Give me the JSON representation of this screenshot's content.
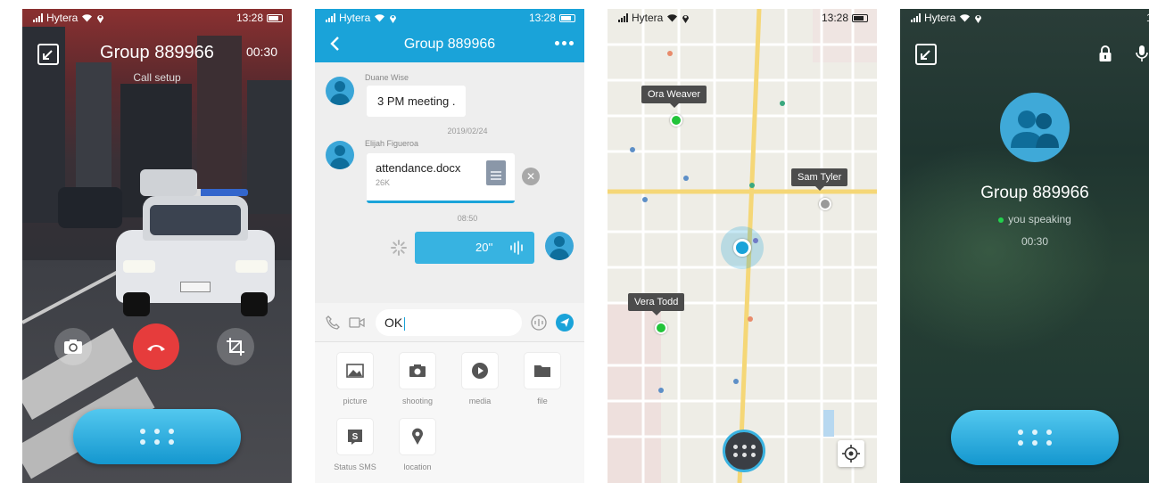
{
  "status_bar": {
    "carrier": "Hytera",
    "time": "13:28"
  },
  "video_call": {
    "title": "Group 889966",
    "timer": "00:30",
    "subtitle": "Call setup"
  },
  "chat": {
    "title": "Group 889966",
    "messages": [
      {
        "sender": "Duane Wise",
        "text": "3 PM meeting ."
      },
      {
        "sender": "Elijah Figueroa",
        "file_name": "attendance.docx",
        "file_size": "26K"
      }
    ],
    "timestamps": [
      "2019/02/24",
      "08:50"
    ],
    "voice_duration": "20''",
    "input_value": "OK",
    "tools": [
      {
        "label": "picture"
      },
      {
        "label": "shooting"
      },
      {
        "label": "media"
      },
      {
        "label": "file"
      },
      {
        "label": "Status SMS"
      },
      {
        "label": "location"
      }
    ]
  },
  "map": {
    "members": [
      {
        "name": "Ora Weaver",
        "status_color": "#22c43a"
      },
      {
        "name": "Sam Tyler",
        "status_color": "#9a9a9a"
      },
      {
        "name": "Vera Todd",
        "status_color": "#22c43a"
      }
    ],
    "self_color": "#1aa3d9"
  },
  "voice_call": {
    "title": "Group 889966",
    "status": "you speaking",
    "timer": "00:30"
  },
  "colors": {
    "accent": "#1aa3d9",
    "hangup": "#e63c3c",
    "online": "#22c43a"
  }
}
